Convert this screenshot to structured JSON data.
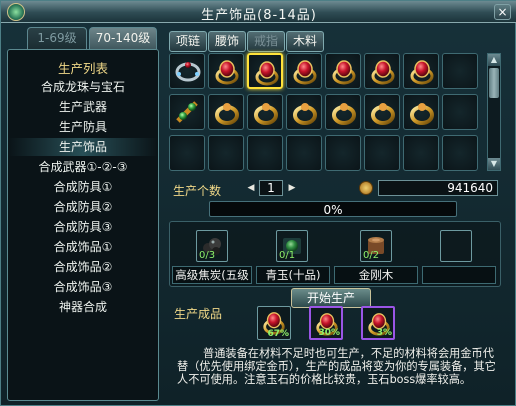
{
  "window": {
    "title": "生产饰品(8-14品)",
    "close_label": "×"
  },
  "level_tabs": [
    {
      "label": "1-69级",
      "active": false
    },
    {
      "label": "70-140级",
      "active": true
    }
  ],
  "sidebar": {
    "header": "生产列表",
    "items": [
      {
        "label": "合成龙珠与宝石",
        "selected": false
      },
      {
        "label": "生产武器",
        "selected": false
      },
      {
        "label": "生产防具",
        "selected": false
      },
      {
        "label": "生产饰品",
        "selected": true
      },
      {
        "label": "合成武器①-②-③",
        "selected": false
      },
      {
        "label": "合成防具①",
        "selected": false
      },
      {
        "label": "合成防具②",
        "selected": false
      },
      {
        "label": "合成防具③",
        "selected": false
      },
      {
        "label": "合成饰品①",
        "selected": false
      },
      {
        "label": "合成饰品②",
        "selected": false
      },
      {
        "label": "合成饰品③",
        "selected": false
      },
      {
        "label": "神器合成",
        "selected": false
      }
    ]
  },
  "category_tabs": [
    {
      "label": "项链",
      "enabled": true
    },
    {
      "label": "腰饰",
      "enabled": true
    },
    {
      "label": "戒指",
      "enabled": false
    },
    {
      "label": "木料",
      "enabled": true
    }
  ],
  "item_grid": {
    "row1": [
      "bracelet-icon",
      "ruby-ring-icon",
      "ruby-ring-icon",
      "ruby-ring-icon",
      "ruby-ring-icon",
      "ruby-ring-icon",
      "ruby-ring-icon",
      "ruby-ring-icon",
      "empty"
    ],
    "row2": [
      "jade-belt-icon",
      "ring-icon",
      "ring-icon",
      "ring-icon",
      "ring-icon",
      "ring-icon",
      "ring-icon",
      "ring-icon",
      "empty"
    ],
    "row3": [
      "empty",
      "empty",
      "empty",
      "empty",
      "empty",
      "empty",
      "empty",
      "empty",
      "empty"
    ],
    "selected_row": 0,
    "selected_col": 2
  },
  "production": {
    "quantity_label": "生产个数",
    "quantity": "1",
    "money": "941640",
    "progress_text": "0%",
    "progress": 0
  },
  "materials": [
    {
      "name": "高级焦炭(五级",
      "count": "0/3",
      "icon": "coal-icon"
    },
    {
      "name": "青玉(十品)",
      "count": "0/1",
      "icon": "jade-icon"
    },
    {
      "name": "金刚木",
      "count": "0/2",
      "icon": "wood-icon"
    },
    {
      "name": "",
      "count": "",
      "icon": "empty"
    }
  ],
  "start_button": "开始生产",
  "products": {
    "label": "生产成品",
    "items": [
      {
        "percent": "67%",
        "rarity": "normal"
      },
      {
        "percent": "30%",
        "rarity": "rare"
      },
      {
        "percent": "3%",
        "rarity": "rare"
      }
    ]
  },
  "note": "普通装备在材料不足时也可生产，不足的材料将会用金币代替（优先使用绑定金币），生产的成品将变为你的专属装备，其它人不可使用。注意玉石的价格比较贵，玉石boss爆率较高。",
  "colors": {
    "accent_yellow": "#f0d888",
    "selected_border": "#ffe23a",
    "rare_border": "#9a55e6",
    "count_green": "#8ef06a"
  }
}
